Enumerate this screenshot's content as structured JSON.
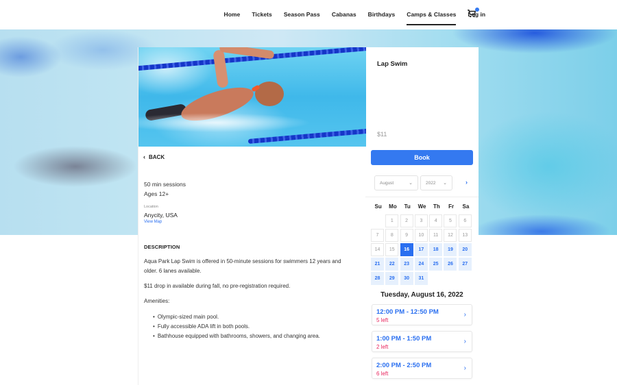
{
  "nav": {
    "items": [
      {
        "label": "Home",
        "active": false
      },
      {
        "label": "Tickets",
        "active": false
      },
      {
        "label": "Season Pass",
        "active": false
      },
      {
        "label": "Cabanas",
        "active": false
      },
      {
        "label": "Birthdays",
        "active": false
      },
      {
        "label": "Camps & Classes",
        "active": true
      },
      {
        "label": "Log in",
        "active": false
      }
    ],
    "cart_icon": "shopping-cart-icon",
    "cart_badge_color": "#3479f0"
  },
  "hero_image": "blurred-pool-background",
  "product_image": "swimmer-in-lap-lane",
  "back": {
    "icon": "chevron-left-icon",
    "label": "BACK"
  },
  "details": {
    "sessions": "50 min sessions",
    "ages": "Ages 12+",
    "location_label": "Location",
    "location": "Anycity, USA",
    "view_map": "View Map"
  },
  "description": {
    "title": "DESCRIPTION",
    "paragraphs": [
      "Aqua Park Lap Swim is offered in 50-minute sessions for swimmers 12 years and older. 6 lanes available.",
      "$11 drop in available during fall, no pre-registration required.",
      "Amenities:"
    ],
    "amenities": [
      "Olympic-sized main pool.",
      "Fully accessible ADA lift in both pools.",
      "Bathhouse equipped with bathrooms, showers, and changing area."
    ]
  },
  "booking": {
    "title": "Lap Swim",
    "price": "$11",
    "book_label": "Book",
    "accent_color": "#3479f0",
    "month_select": "August",
    "year_select": "2022",
    "next_icon": "chevron-right-icon",
    "weekdays": [
      "Su",
      "Mo",
      "Tu",
      "We",
      "Th",
      "Fr",
      "Sa"
    ],
    "first_weekday_offset": 1,
    "days_in_month": 31,
    "selected_day": 16,
    "first_available_day": 17,
    "selected_date_label": "Tuesday, August 16, 2022",
    "slots": [
      {
        "time": "12:00 PM - 12:50 PM",
        "remaining": "5 left"
      },
      {
        "time": "1:00 PM - 1:50 PM",
        "remaining": "2 left"
      },
      {
        "time": "2:00 PM - 2:50 PM",
        "remaining": "6 left"
      }
    ],
    "remaining_color": "#e8265e"
  }
}
